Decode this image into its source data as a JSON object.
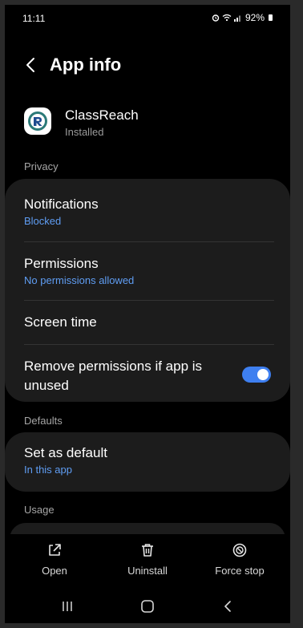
{
  "status": {
    "time": "11:11",
    "battery": "92%"
  },
  "header": {
    "title": "App info"
  },
  "app": {
    "name": "ClassReach",
    "status": "Installed"
  },
  "privacy": {
    "label": "Privacy",
    "notifications": {
      "title": "Notifications",
      "sub": "Blocked"
    },
    "permissions": {
      "title": "Permissions",
      "sub": "No permissions allowed"
    },
    "screen_time": {
      "title": "Screen time"
    },
    "remove_permissions": {
      "title": "Remove permissions if app is unused",
      "enabled": true
    }
  },
  "defaults": {
    "label": "Defaults",
    "set_default": {
      "title": "Set as default",
      "sub": "In this app"
    }
  },
  "usage": {
    "label": "Usage"
  },
  "actions": {
    "open": "Open",
    "uninstall": "Uninstall",
    "force_stop": "Force stop"
  },
  "colors": {
    "accent": "#3e7ff0",
    "link": "#5f9df3",
    "card": "#1c1c1c",
    "background": "#000000"
  }
}
